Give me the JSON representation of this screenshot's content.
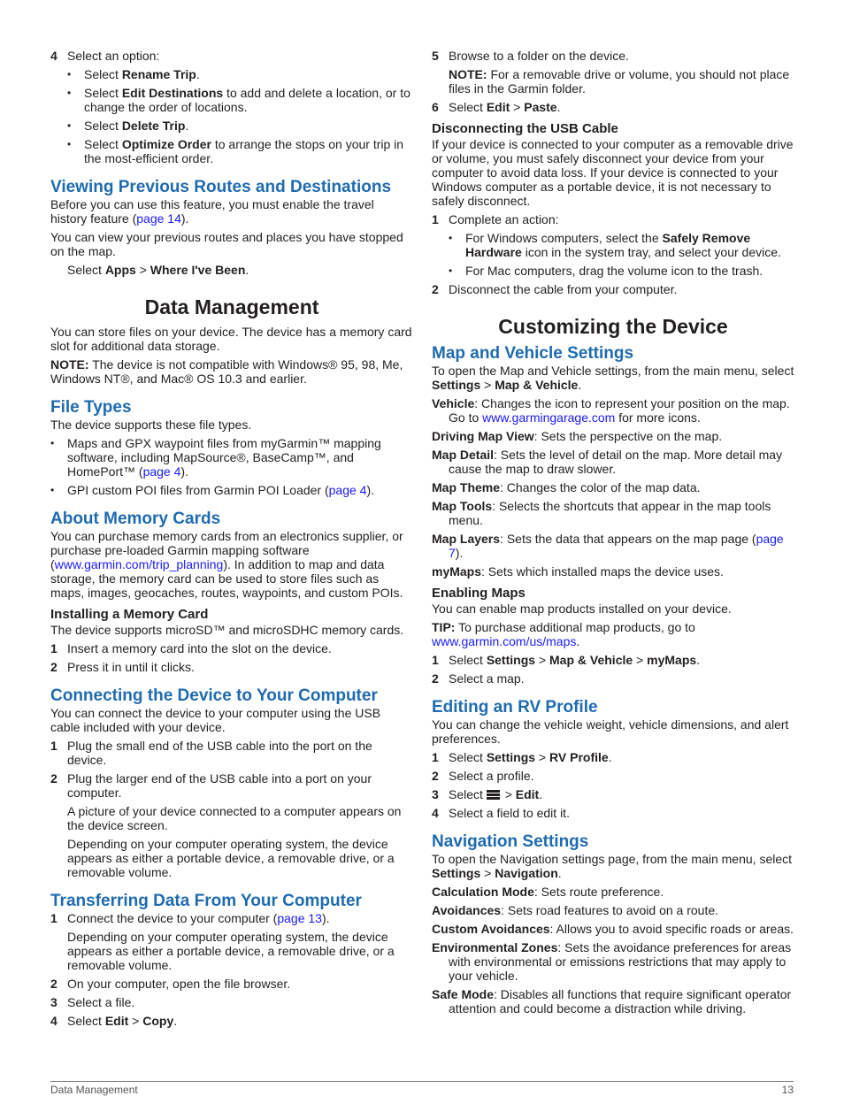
{
  "left": {
    "step4": {
      "num": "4",
      "text": "Select an option:"
    },
    "step4_options": [
      {
        "pre": "Select ",
        "bold": "Rename Trip",
        "post": "."
      },
      {
        "pre": "Select ",
        "bold": "Edit Destinations",
        "post": " to add and delete a location, or to change the order of locations."
      },
      {
        "pre": "Select ",
        "bold": "Delete Trip",
        "post": "."
      },
      {
        "pre": "Select ",
        "bold": "Optimize Order",
        "post": " to arrange the stops on your trip in the most-efficient order."
      }
    ],
    "viewing": {
      "heading": "Viewing Previous Routes and Destinations",
      "p1_pre": "Before you can use this feature, you must enable the travel history feature (",
      "p1_link": "page 14",
      "p1_post": ").",
      "p2": "You can view your previous routes and places you have stopped on the map.",
      "p3_pre": "Select ",
      "p3_b1": "Apps",
      "p3_sep": " > ",
      "p3_b2": "Where I've Been",
      "p3_post": "."
    },
    "data_mgmt": {
      "heading": "Data Management",
      "p1": "You can store files on your device. The device has a memory card slot for additional data storage.",
      "note_label": "NOTE:",
      "note_text": " The device is not compatible with Windows® 95, 98, Me, Windows NT®, and Mac® OS 10.3 and earlier."
    },
    "file_types": {
      "heading": "File Types",
      "p1": "The device supports these file types.",
      "b1_text": "Maps and GPX waypoint files from myGarmin™ mapping software, including MapSource®, BaseCamp™, and HomePort™ (",
      "b1_link": "page 4",
      "b1_post": ").",
      "b2_text": "GPI custom POI files from Garmin POI Loader (",
      "b2_link": "page 4",
      "b2_post": ")."
    },
    "memory_cards": {
      "heading": "About Memory Cards",
      "p1_pre": "You can purchase memory cards from an electronics supplier, or purchase pre-loaded Garmin mapping software (",
      "p1_link": "www.garmin.com/trip_planning",
      "p1_post": "). In addition to map and data storage, the memory card can be used to store files such as maps, images, geocaches, routes, waypoints, and custom POIs.",
      "sub_heading": "Installing a Memory Card",
      "sub_p": "The device supports microSD™ and microSDHC memory cards.",
      "steps": [
        {
          "num": "1",
          "text": "Insert a memory card into the slot on the device."
        },
        {
          "num": "2",
          "text": "Press it in until it clicks."
        }
      ]
    },
    "connecting": {
      "heading": "Connecting the Device to Your Computer",
      "p1": "You can connect the device to your computer using the USB cable included with your device.",
      "step1": {
        "num": "1",
        "text": "Plug the small end of the USB cable into the port on the device."
      },
      "step2": {
        "num": "2",
        "text": "Plug the larger end of the USB cable into a port on your computer."
      },
      "note1": "A picture of your device connected to a computer appears on the device screen.",
      "note2": "Depending on your computer operating system, the device appears as either a portable device, a removable drive, or a removable volume."
    },
    "transferring": {
      "heading": "Transferring Data From Your Computer",
      "step1": {
        "num": "1",
        "pre": "Connect the device to your computer (",
        "link": "page 13",
        "post": ")."
      },
      "note1": "Depending on your computer operating system, the device appears as either a portable device, a removable drive, or a removable volume.",
      "step2": {
        "num": "2",
        "text": "On your computer, open the file browser."
      },
      "step3": {
        "num": "3",
        "text": "Select a file."
      },
      "step4": {
        "num": "4",
        "pre": "Select ",
        "b1": "Edit",
        "sep": " > ",
        "b2": "Copy",
        "post": "."
      }
    }
  },
  "right": {
    "step5": {
      "num": "5",
      "text": "Browse to a folder on the device."
    },
    "step5_note_label": "NOTE:",
    "step5_note_text": " For a removable drive or volume, you should not place files in the Garmin folder.",
    "step6": {
      "num": "6",
      "pre": "Select ",
      "b1": "Edit",
      "sep": " > ",
      "b2": "Paste",
      "post": "."
    },
    "disconnecting": {
      "heading": "Disconnecting the USB Cable",
      "p1": "If your device is connected to your computer as a removable drive or volume, you must safely disconnect your device from your computer to avoid data loss. If your device is connected to your Windows computer as a portable device, it is not necessary to safely disconnect.",
      "step1": {
        "num": "1",
        "text": "Complete an action:"
      },
      "b1_pre": "For Windows computers, select the ",
      "b1_bold": "Safely Remove Hardware",
      "b1_post": " icon in the system tray, and select your device.",
      "b2": "For Mac computers, drag the volume icon to the trash.",
      "step2": {
        "num": "2",
        "text": "Disconnect the cable from your computer."
      }
    },
    "customizing": {
      "heading": "Customizing the Device"
    },
    "map_vehicle": {
      "heading": "Map and Vehicle Settings",
      "intro_pre": "To open the Map and Vehicle settings, from the main menu, select ",
      "intro_b1": "Settings",
      "intro_sep": " > ",
      "intro_b2": "Map & Vehicle",
      "intro_post": ".",
      "defs": [
        {
          "term": "Vehicle",
          "pre": ": Changes the icon to represent your position on the map. Go to ",
          "link": "www.garmingarage.com",
          "post": " for more icons."
        },
        {
          "term": "Driving Map View",
          "pre": ": Sets the perspective on the map.",
          "link": "",
          "post": ""
        },
        {
          "term": "Map Detail",
          "pre": ": Sets the level of detail on the map. More detail may cause the map to draw slower.",
          "link": "",
          "post": ""
        },
        {
          "term": "Map Theme",
          "pre": ": Changes the color of the map data.",
          "link": "",
          "post": ""
        },
        {
          "term": "Map Tools",
          "pre": ": Selects the shortcuts that appear in the map tools menu.",
          "link": "",
          "post": ""
        },
        {
          "term": "Map Layers",
          "pre": ": Sets the data that appears on the map page (",
          "link": "page 7",
          "post": ")."
        },
        {
          "term": "myMaps",
          "pre": ": Sets which installed maps the device uses.",
          "link": "",
          "post": ""
        }
      ]
    },
    "enabling_maps": {
      "heading": "Enabling Maps",
      "p1": "You can enable map products installed on your device.",
      "tip_label": "TIP:",
      "tip_text": " To purchase additional map products, go to ",
      "tip_link": "www.garmin.com/us/maps",
      "tip_post": ".",
      "step1": {
        "num": "1",
        "pre": "Select ",
        "b1": "Settings",
        "sep1": " > ",
        "b2": "Map & Vehicle",
        "sep2": " > ",
        "b3": "myMaps",
        "post": "."
      },
      "step2": {
        "num": "2",
        "text": "Select a map."
      }
    },
    "rv_profile": {
      "heading": "Editing an RV Profile",
      "p1": "You can change the vehicle weight, vehicle dimensions, and alert preferences.",
      "step1": {
        "num": "1",
        "pre": "Select ",
        "b1": "Settings",
        "sep": " > ",
        "b2": "RV Profile",
        "post": "."
      },
      "step2": {
        "num": "2",
        "text": "Select a profile."
      },
      "step3": {
        "num": "3",
        "pre": "Select ",
        "icon": "menu-icon",
        "sep": " > ",
        "b1": "Edit",
        "post": "."
      },
      "step4": {
        "num": "4",
        "text": "Select a field to edit it."
      }
    },
    "navigation": {
      "heading": "Navigation Settings",
      "intro_pre": "To open the Navigation settings page, from the main menu, select ",
      "intro_b1": "Settings",
      "intro_sep": " > ",
      "intro_b2": "Navigation",
      "intro_post": ".",
      "defs": [
        {
          "term": "Calculation Mode",
          "text": ": Sets route preference."
        },
        {
          "term": "Avoidances",
          "text": ": Sets road features to avoid on a route."
        },
        {
          "term": "Custom Avoidances",
          "text": ": Allows you to avoid specific roads or areas."
        },
        {
          "term": "Environmental Zones",
          "text": ": Sets the avoidance preferences for areas with environmental or emissions restrictions that may apply to your vehicle."
        },
        {
          "term": "Safe Mode",
          "text": ": Disables all functions that require significant operator attention and could become a distraction while driving."
        }
      ]
    }
  },
  "footer": {
    "section": "Data Management",
    "page_number": "13"
  },
  "colors": {
    "heading_blue": "#1f6bb0",
    "link_blue": "#1a1aff",
    "text": "#231f20"
  }
}
